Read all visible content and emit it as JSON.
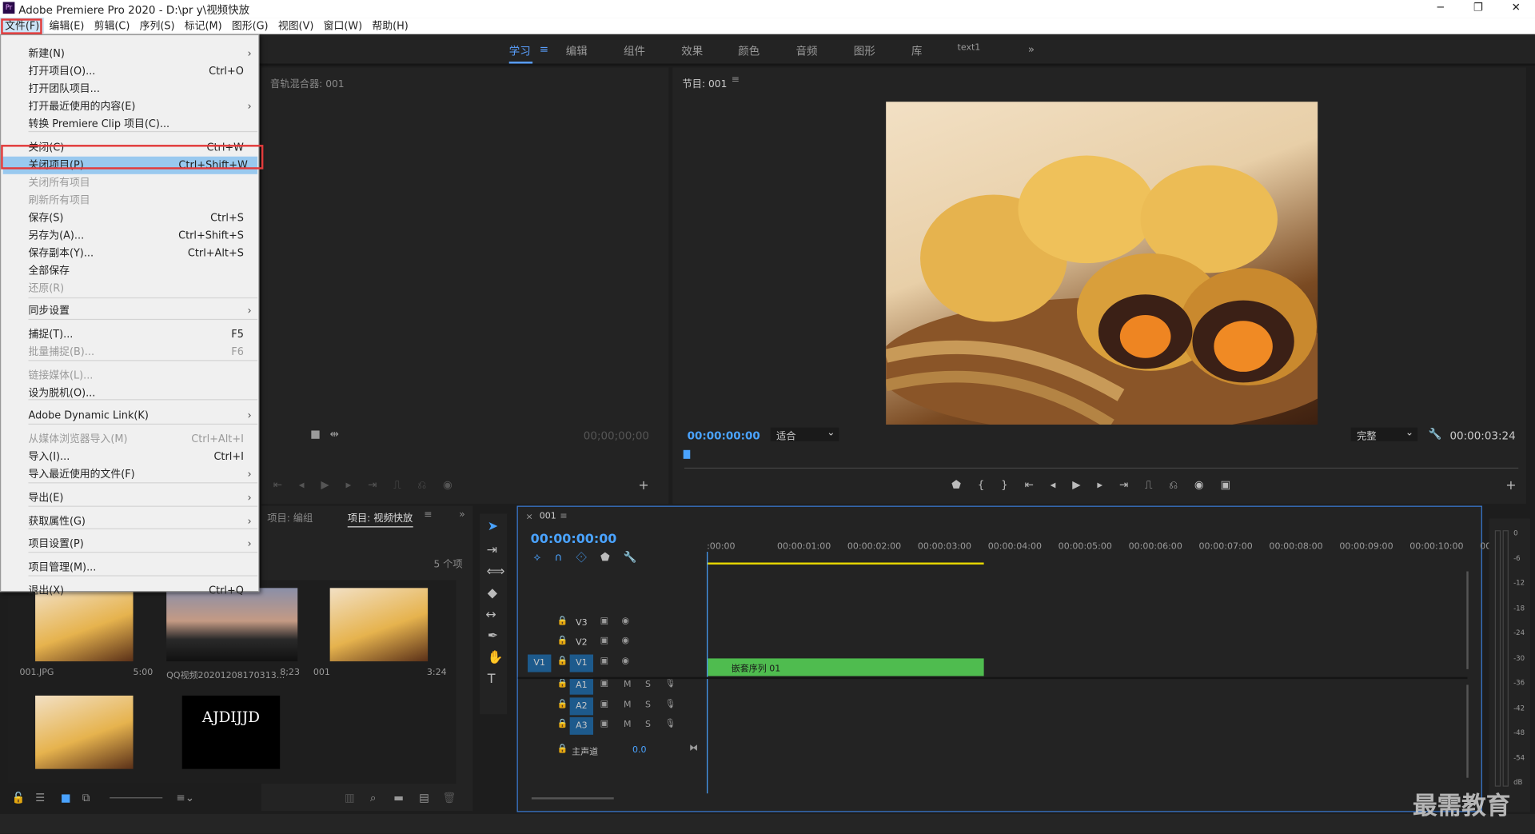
{
  "window": {
    "title": "Adobe Premiere Pro 2020 - D:\\pr y\\视频快放",
    "min": "─",
    "max": "❐",
    "close": "✕"
  },
  "menubar": [
    "文件(F)",
    "编辑(E)",
    "剪辑(C)",
    "序列(S)",
    "标记(M)",
    "图形(G)",
    "视图(V)",
    "窗口(W)",
    "帮助(H)"
  ],
  "workspaces": [
    "学习",
    "编辑",
    "组件",
    "效果",
    "颜色",
    "音频",
    "图形",
    "库",
    "text1"
  ],
  "file_menu": [
    {
      "label": "新建(N)",
      "key": "",
      "sub": true
    },
    {
      "label": "打开项目(O)...",
      "key": "Ctrl+O"
    },
    {
      "label": "打开团队项目...",
      "key": ""
    },
    {
      "label": "打开最近使用的内容(E)",
      "key": "",
      "sub": true
    },
    {
      "label": "转换 Premiere Clip 项目(C)...",
      "key": ""
    },
    {
      "label": "关闭(C)",
      "key": "Ctrl+W"
    },
    {
      "label": "关闭项目(P)",
      "key": "Ctrl+Shift+W"
    },
    {
      "label": "关闭所有项目",
      "key": ""
    },
    {
      "label": "刷新所有项目",
      "key": ""
    },
    {
      "label": "保存(S)",
      "key": "Ctrl+S"
    },
    {
      "label": "另存为(A)...",
      "key": "Ctrl+Shift+S"
    },
    {
      "label": "保存副本(Y)...",
      "key": "Ctrl+Alt+S"
    },
    {
      "label": "全部保存",
      "key": ""
    },
    {
      "label": "还原(R)",
      "key": ""
    },
    {
      "label": "同步设置",
      "key": "",
      "sub": true
    },
    {
      "label": "捕捉(T)...",
      "key": "F5"
    },
    {
      "label": "批量捕捉(B)...",
      "key": "F6"
    },
    {
      "label": "链接媒体(L)...",
      "key": ""
    },
    {
      "label": "设为脱机(O)...",
      "key": ""
    },
    {
      "label": "Adobe Dynamic Link(K)",
      "key": "",
      "sub": true
    },
    {
      "label": "从媒体浏览器导入(M)",
      "key": "Ctrl+Alt+I"
    },
    {
      "label": "导入(I)...",
      "key": "Ctrl+I"
    },
    {
      "label": "导入最近使用的文件(F)",
      "key": "",
      "sub": true
    },
    {
      "label": "导出(E)",
      "key": "",
      "sub": true
    },
    {
      "label": "获取属性(G)",
      "key": "",
      "sub": true
    },
    {
      "label": "项目设置(P)",
      "key": "",
      "sub": true
    },
    {
      "label": "项目管理(M)...",
      "key": ""
    },
    {
      "label": "退出(X)",
      "key": "Ctrl+Q"
    }
  ],
  "audio_mixer": {
    "title": "音轨混合器: 001",
    "timecode": "00;00;00;00"
  },
  "program": {
    "title": "节目: 001",
    "timecode": "00:00:00:00",
    "fit": "适合",
    "quality": "完整",
    "duration": "00:00:03:24"
  },
  "project": {
    "tab1": "项目: 编组",
    "tab2": "项目: 视频快放",
    "count": "5 个项",
    "items": [
      {
        "name": "001.JPG",
        "dur": "5:00"
      },
      {
        "name": "QQ视频20201208170313...",
        "dur": "8;23"
      },
      {
        "name": "001",
        "dur": "3:24"
      },
      {
        "name": "",
        "dur": ""
      },
      {
        "name": "AJDIJJD",
        "dur": ""
      }
    ]
  },
  "timeline": {
    "tab": "001",
    "timecode": "00:00:00:00",
    "ruler": [
      ":00:00",
      "00:00:01:00",
      "00:00:02:00",
      "00:00:03:00",
      "00:00:04:00",
      "00:00:05:00",
      "00:00:06:00",
      "00:00:07:00",
      "00:00:08:00",
      "00:00:09:00",
      "00:00:10:00",
      "00"
    ],
    "video_tracks": [
      "V3",
      "V2",
      "V1"
    ],
    "audio_tracks": [
      "A1",
      "A2",
      "A3"
    ],
    "source_patch": "V1",
    "master": "主声道",
    "master_val": "0.0",
    "clip": "嵌套序列 01",
    "M": "M",
    "S": "S"
  },
  "meter": [
    "0",
    "-6",
    "-12",
    "-18",
    "-24",
    "-30",
    "-36",
    "-42",
    "-48",
    "-54",
    "dB"
  ],
  "watermark": "最需教育"
}
